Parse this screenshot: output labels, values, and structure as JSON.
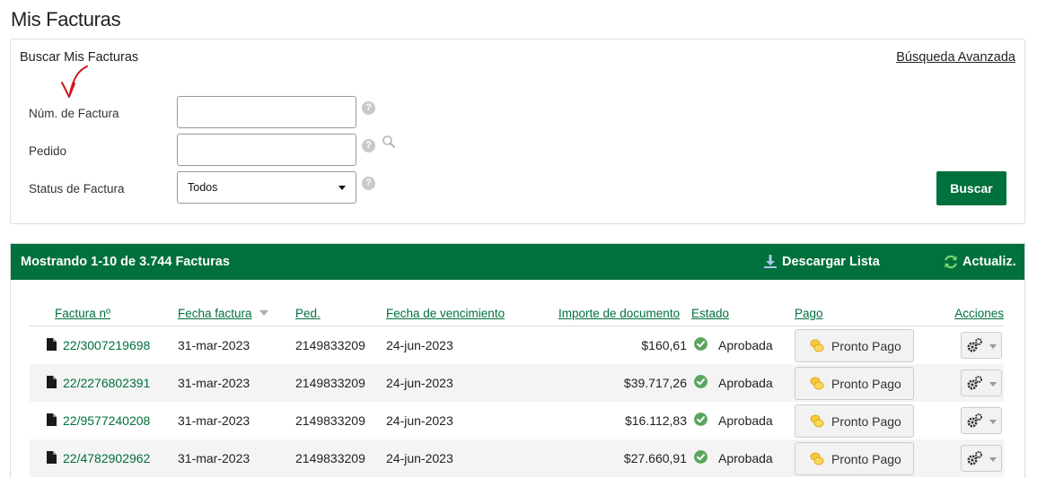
{
  "page_title": "Mis Facturas",
  "search": {
    "title": "Buscar Mis Facturas",
    "advanced_link": "Búsqueda Avanzada",
    "fields": {
      "invoice_label": "Núm. de Factura",
      "invoice_value": "",
      "order_label": "Pedido",
      "order_value": "",
      "status_label": "Status de Factura",
      "status_selected": "Todos"
    },
    "button": "Buscar"
  },
  "list": {
    "showing_text": "Mostrando 1-10 de 3.744 Facturas",
    "download_label": "Descargar Lista",
    "refresh_label": "Actualiz.",
    "columns": {
      "invoice": "Factura nº",
      "date": "Fecha factura",
      "order": "Ped.",
      "due": "Fecha de vencimiento",
      "amount": "Importe de documento",
      "status": "Estado",
      "payment": "Pago",
      "actions": "Acciones"
    },
    "rows": [
      {
        "invoice": "22/3007219698",
        "date": "31-mar-2023",
        "order": "2149833209",
        "due": "24-jun-2023",
        "amount": "$160,61",
        "status": "Aprobada",
        "payment": "Pronto Pago"
      },
      {
        "invoice": "22/2276802391",
        "date": "31-mar-2023",
        "order": "2149833209",
        "due": "24-jun-2023",
        "amount": "$39.717,26",
        "status": "Aprobada",
        "payment": "Pronto Pago"
      },
      {
        "invoice": "22/9577240208",
        "date": "31-mar-2023",
        "order": "2149833209",
        "due": "24-jun-2023",
        "amount": "$16.112,83",
        "status": "Aprobada",
        "payment": "Pronto Pago"
      },
      {
        "invoice": "22/4782902962",
        "date": "31-mar-2023",
        "order": "2149833209",
        "due": "24-jun-2023",
        "amount": "$27.660,91",
        "status": "Aprobada",
        "payment": "Pronto Pago"
      }
    ]
  },
  "colors": {
    "brand_green": "#00703c",
    "status_check": "#5aa55f",
    "annotation_red": "#d0141e"
  },
  "icons": [
    "help-icon",
    "search-icon",
    "chevron-down-icon",
    "download-icon",
    "refresh-icon",
    "document-icon",
    "check-circle-icon",
    "coins-icon",
    "gear-icon",
    "sort-desc-icon",
    "red-arrow-annotation"
  ]
}
